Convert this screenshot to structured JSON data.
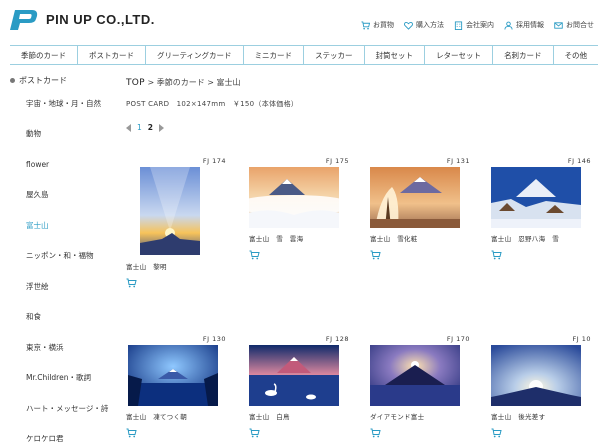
{
  "header": {
    "brand": "PIN UP CO.,LTD.",
    "brand_color": "#2a9bc4",
    "links": [
      {
        "label": "お買物",
        "icon": "cart-icon"
      },
      {
        "label": "購入方法",
        "icon": "heart-icon"
      },
      {
        "label": "会社案内",
        "icon": "building-icon"
      },
      {
        "label": "採用情報",
        "icon": "person-icon"
      },
      {
        "label": "お問合せ",
        "icon": "mail-icon"
      }
    ]
  },
  "mainnav": {
    "items": [
      "季節のカード",
      "ポストカード",
      "グリーティングカード",
      "ミニカード",
      "ステッカー",
      "封筒セット",
      "レターセット",
      "名刺カード",
      "その他"
    ]
  },
  "sidebar": {
    "heading": "ポストカード",
    "items": [
      "宇宙・地球・月・自然",
      "動物",
      "flower",
      "屋久島",
      "富士山",
      "ニッポン・和・福物",
      "浮世絵",
      "和食",
      "東京・横浜",
      "Mr.Children・歌詞",
      "ハート・メッセージ・詩",
      "ケロケロ君"
    ],
    "active": "富士山",
    "active_color": "#2a9bc4"
  },
  "breadcrumb": {
    "top": "TOP",
    "sep1": " > ",
    "level2": "季節のカード",
    "sep2": " > ",
    "level3": "富士山"
  },
  "description": "POST CARD　102×147mm　￥150（本体価格）",
  "pager": {
    "pages": [
      "1",
      "2"
    ],
    "current": "2"
  },
  "products": [
    {
      "code": "FJ 174",
      "title": "富士山　黎明"
    },
    {
      "code": "FJ 175",
      "title": "富士山　雪　雲海"
    },
    {
      "code": "FJ 131",
      "title": "富士山　雪化粧"
    },
    {
      "code": "FJ 146",
      "title": "富士山　忍野八海　雪"
    },
    {
      "code": "FJ 130",
      "title": "富士山　凍てつく朝"
    },
    {
      "code": "FJ 128",
      "title": "富士山　白鳥"
    },
    {
      "code": "FJ 170",
      "title": "ダイアモンド富士"
    },
    {
      "code": "FJ 10",
      "title": "富士山　後光差す"
    }
  ]
}
